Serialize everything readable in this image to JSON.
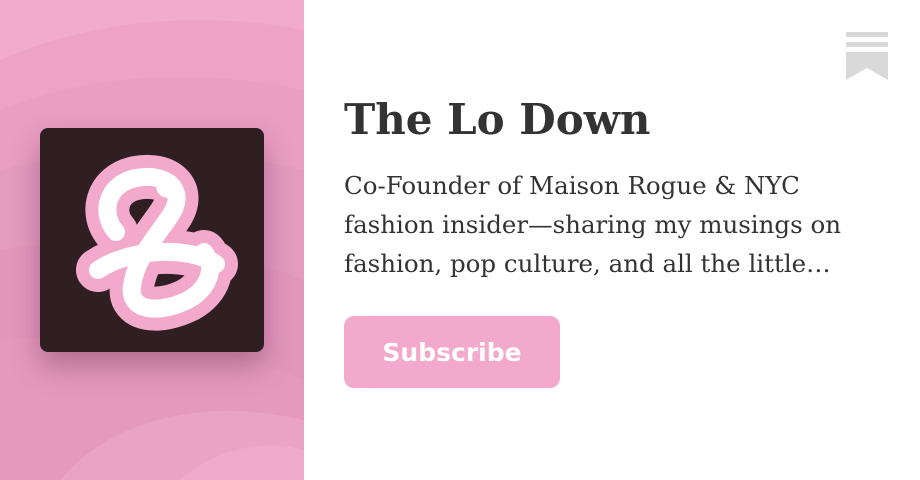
{
  "publication": {
    "title": "The Lo Down",
    "description": "Co-Founder of Maison Rogue & NYC fashion insider—sharing my musings on fashion, pop culture, and all the little…"
  },
  "actions": {
    "subscribe_label": "Subscribe"
  },
  "icons": {
    "logo": "script-l-logo-icon",
    "bookmark": "substack-bookmark-icon"
  },
  "colors": {
    "brand_pink": "#f2a9cc",
    "logo_background": "#2f1f22",
    "text": "#333333",
    "bookmark_gray": "#d9d9d9"
  }
}
